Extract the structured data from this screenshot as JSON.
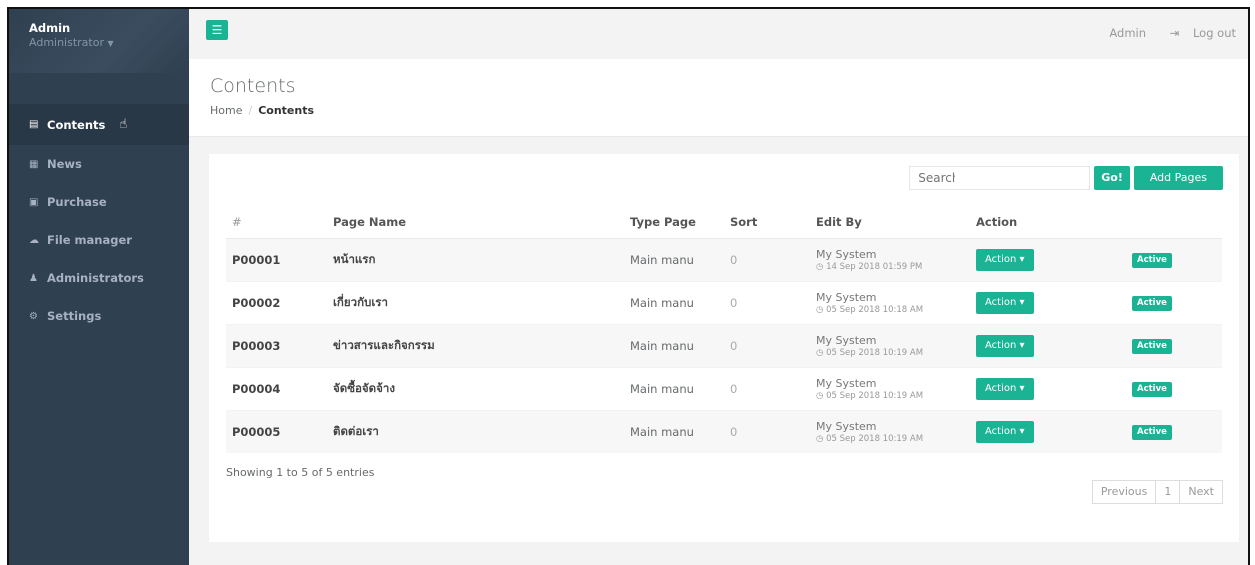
{
  "sidebar": {
    "user_name": "Admin",
    "user_role": "Administrator",
    "items": [
      {
        "label": "Contents",
        "icon": "list-alt-icon"
      },
      {
        "label": "News",
        "icon": "newspaper-icon"
      },
      {
        "label": "Purchase",
        "icon": "file-text-icon"
      },
      {
        "label": "File manager",
        "icon": "cloud-icon"
      },
      {
        "label": "Administrators",
        "icon": "users-icon"
      },
      {
        "label": "Settings",
        "icon": "cogs-icon"
      }
    ]
  },
  "topbar": {
    "user": "Admin",
    "logout": "Log out"
  },
  "page": {
    "title": "Contents",
    "breadcrumb_home": "Home",
    "breadcrumb_current": "Contents"
  },
  "toolbar": {
    "search_placeholder": "Search",
    "go_label": "Go!",
    "add_label": "Add Pages"
  },
  "table": {
    "headers": [
      "#",
      "Page Name",
      "Type Page",
      "Sort",
      "Edit By",
      "Action"
    ],
    "rows": [
      {
        "id": "P00001",
        "name": "หน้าแรก",
        "type": "Main manu",
        "sort": "0",
        "editor": "My System",
        "date": "14 Sep 2018 01:59 PM",
        "action": "Action",
        "status": "Active"
      },
      {
        "id": "P00002",
        "name": "เกี่ยวกับเรา",
        "type": "Main manu",
        "sort": "0",
        "editor": "My System",
        "date": "05 Sep 2018 10:18 AM",
        "action": "Action",
        "status": "Active"
      },
      {
        "id": "P00003",
        "name": "ข่าวสารและกิจกรรม",
        "type": "Main manu",
        "sort": "0",
        "editor": "My System",
        "date": "05 Sep 2018 10:19 AM",
        "action": "Action",
        "status": "Active"
      },
      {
        "id": "P00004",
        "name": "จัดซื้อจัดจ้าง",
        "type": "Main manu",
        "sort": "0",
        "editor": "My System",
        "date": "05 Sep 2018 10:19 AM",
        "action": "Action",
        "status": "Active"
      },
      {
        "id": "P00005",
        "name": "ติดต่อเรา",
        "type": "Main manu",
        "sort": "0",
        "editor": "My System",
        "date": "05 Sep 2018 10:19 AM",
        "action": "Action",
        "status": "Active"
      }
    ]
  },
  "footer": {
    "info": "Showing 1 to 5 of 5 entries",
    "prev": "Previous",
    "page": "1",
    "next": "Next"
  },
  "colors": {
    "accent": "#1ab394",
    "sidebar": "#2f4050"
  }
}
